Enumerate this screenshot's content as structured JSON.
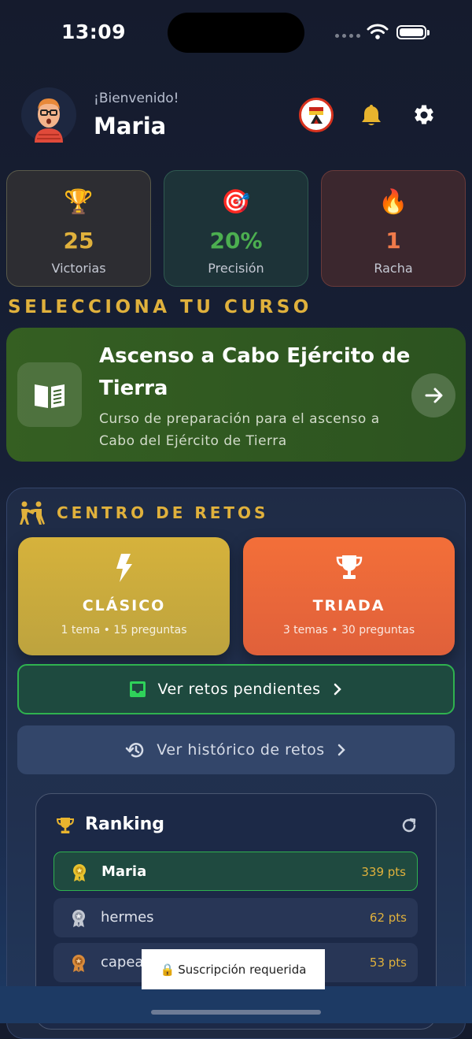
{
  "status_bar": {
    "time": "13:09"
  },
  "header": {
    "welcome": "¡Bienvenido!",
    "username": "Maria"
  },
  "stats": [
    {
      "value": "25",
      "label": "Victorias",
      "icon": "trophy-icon",
      "color": "#e0b13c"
    },
    {
      "value": "20%",
      "label": "Precisión",
      "icon": "target-icon",
      "color": "#4caf50"
    },
    {
      "value": "1",
      "label": "Racha",
      "icon": "fire-icon",
      "color": "#f07a4a"
    }
  ],
  "course_section": {
    "title": "SELECCIONA TU CURSO",
    "course": {
      "title": "Ascenso a Cabo Ejército de Tierra",
      "description": "Curso de preparación para el ascenso a Cabo del Ejército de Tierra"
    }
  },
  "challenges": {
    "title": "CENTRO DE RETOS",
    "modes": [
      {
        "title": "CLÁSICO",
        "subtitle": "1 tema • 15 preguntas",
        "icon": "lightning-icon"
      },
      {
        "title": "TRIADA",
        "subtitle": "3 temas • 30 preguntas",
        "icon": "trophy-icon"
      }
    ],
    "pending_label": "Ver retos pendientes",
    "history_label": "Ver histórico de retos"
  },
  "ranking": {
    "title": "Ranking",
    "rows": [
      {
        "name": "Maria",
        "points": "339 pts"
      },
      {
        "name": "hermes",
        "points": "62 pts"
      },
      {
        "name": "capea",
        "points": "53 pts"
      }
    ]
  },
  "toast": {
    "text": "Suscripción requerida"
  },
  "colors": {
    "accent_gold": "#e0b13c",
    "green": "#2fb24f",
    "orange": "#f36f39"
  }
}
